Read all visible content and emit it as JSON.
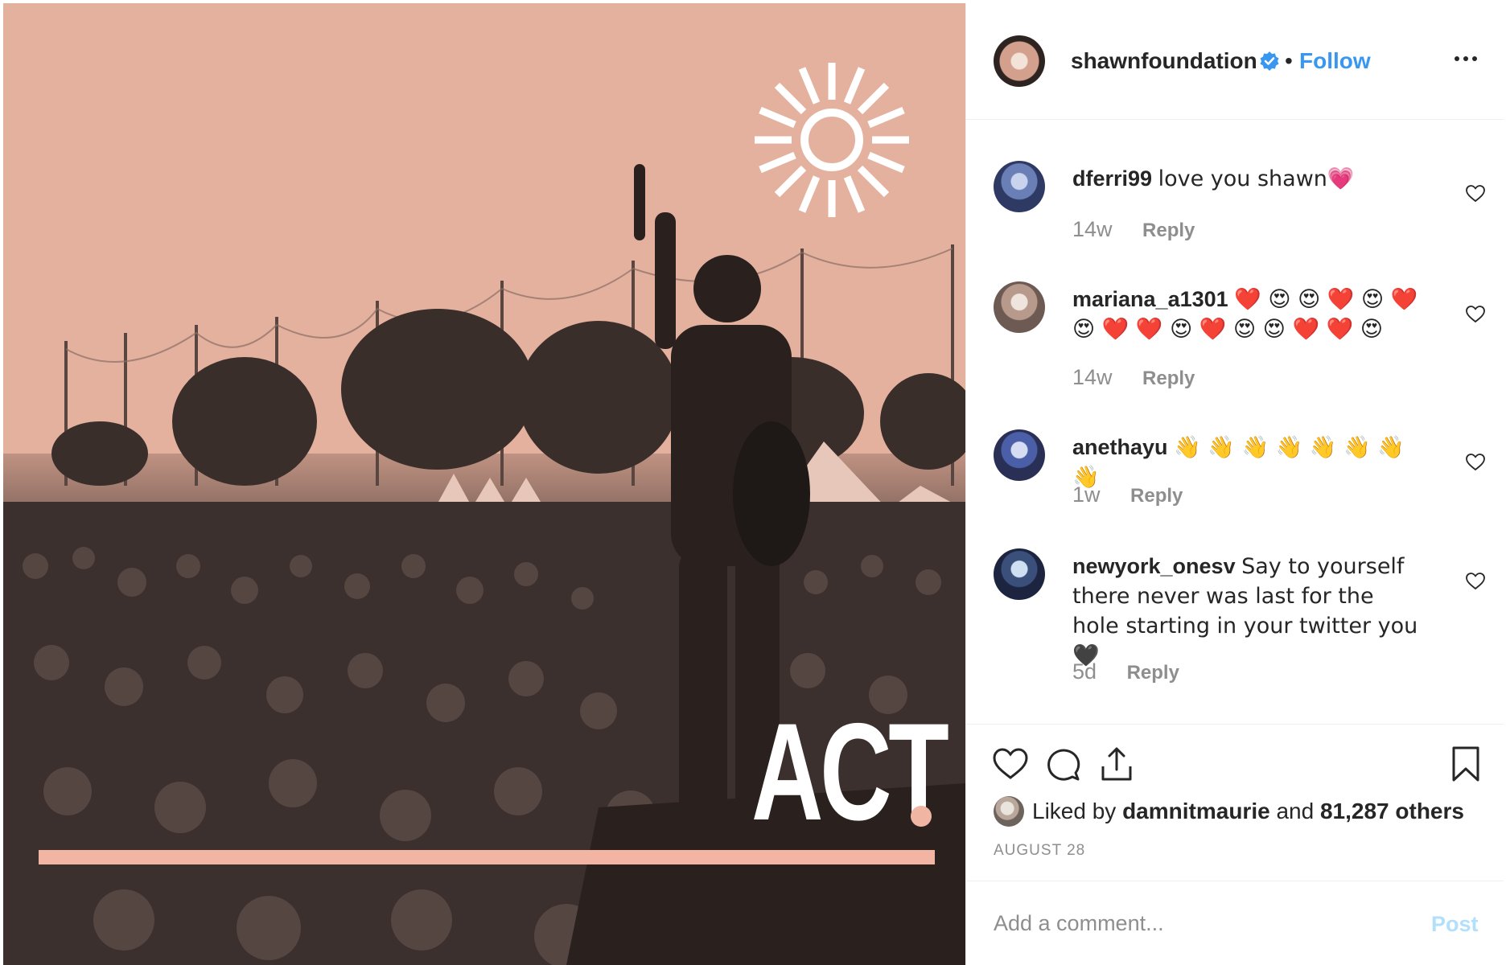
{
  "post_image": {
    "overlay_text": "ACT",
    "overlay_text_suffix": "."
  },
  "header": {
    "username": "shawnfoundation",
    "separator": "•",
    "follow_label": "Follow",
    "verified_icon": "verified-badge-icon",
    "more_icon": "more-options-icon"
  },
  "comments": [
    {
      "user": "dferri99",
      "text": "love you shawn💗",
      "time": "14w",
      "reply_label": "Reply",
      "avatar_color": "#6a7fb6"
    },
    {
      "user": "mariana_a1301",
      "text": "❤️ 😍 😍 ❤️ 😍 ❤️ 😍 ❤️ ❤️ 😍 ❤️ 😍 😍 ❤️ ❤️ 😍",
      "time": "14w",
      "reply_label": "Reply",
      "avatar_color": "#b89a8c"
    },
    {
      "user": "anethayu",
      "text": "👋 👋 👋 👋 👋 👋 👋 👋",
      "time": "1w",
      "reply_label": "Reply",
      "avatar_color": "#4a5fa8"
    },
    {
      "user": "newyork_onesv",
      "text": "Say to yourself there never was last for the hole starting in your twitter you 🖤",
      "time": "5d",
      "reply_label": "Reply",
      "avatar_color": "#3a4f7a"
    }
  ],
  "actions": {
    "like_icon": "heart-icon",
    "comment_icon": "comment-bubble-icon",
    "share_icon": "share-icon",
    "save_icon": "bookmark-icon"
  },
  "likes": {
    "prefix": "Liked by ",
    "user": "damnitmaurie",
    "middle": " and ",
    "count": "81,287 others"
  },
  "post_date": "AUGUST 28",
  "add_comment": {
    "placeholder": "Add a comment...",
    "post_label": "Post"
  },
  "colors": {
    "link_blue": "#3897f0",
    "post_disabled": "#b2dffc",
    "image_tint": "#e8b6a3",
    "accent_bar": "#f2b5a4"
  }
}
